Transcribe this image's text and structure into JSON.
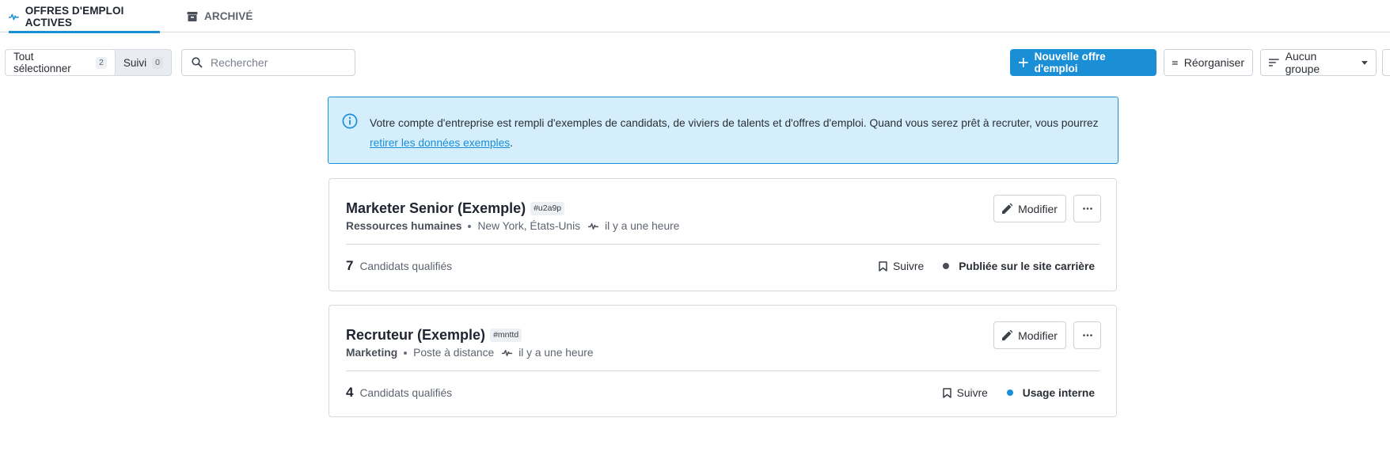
{
  "tabs": [
    {
      "label": "OFFRES D'EMPLOI ACTIVES",
      "icon": "pulse-icon",
      "active": true
    },
    {
      "label": "ARCHIVÉ",
      "icon": "archive-icon",
      "active": false
    }
  ],
  "toolbar": {
    "select_all_label": "Tout sélectionner",
    "select_all_count": "2",
    "followed_label": "Suivi",
    "followed_count": "0",
    "search_placeholder": "Rechercher",
    "search_value": "",
    "new_job_label": "Nouvelle offre d'emploi",
    "reorganize_label": "Réorganiser",
    "group_label": "Aucun groupe"
  },
  "banner": {
    "text_before": "Votre compte d'entreprise est rempli d'exemples de candidats, de viviers de talents et d'offres d'emploi. Quand vous serez prêt à recruter, vous pourrez ",
    "link_text": "retirer les données exemples",
    "text_after": "."
  },
  "jobs": [
    {
      "title": "Marketer Senior (Exemple)",
      "tag": "#u2a9p",
      "department": "Ressources humaines",
      "location": "New York, États-Unis",
      "activity": "il y a une heure",
      "edit_label": "Modifier",
      "candidates_count": "7",
      "candidates_label": "Candidats qualifiés",
      "follow_label": "Suivre",
      "status_label": "Publiée sur le site carrière",
      "status_color": "#4a4f57"
    },
    {
      "title": "Recruteur (Exemple)",
      "tag": "#mnttd",
      "department": "Marketing",
      "location": "Poste à distance",
      "activity": "il y a une heure",
      "edit_label": "Modifier",
      "candidates_count": "4",
      "candidates_label": "Candidats qualifiés",
      "follow_label": "Suivre",
      "status_label": "Usage interne",
      "status_color": "#1a8fd6"
    }
  ],
  "colors": {
    "accent": "#1a8fd6",
    "banner_bg": "#d4eefc"
  }
}
